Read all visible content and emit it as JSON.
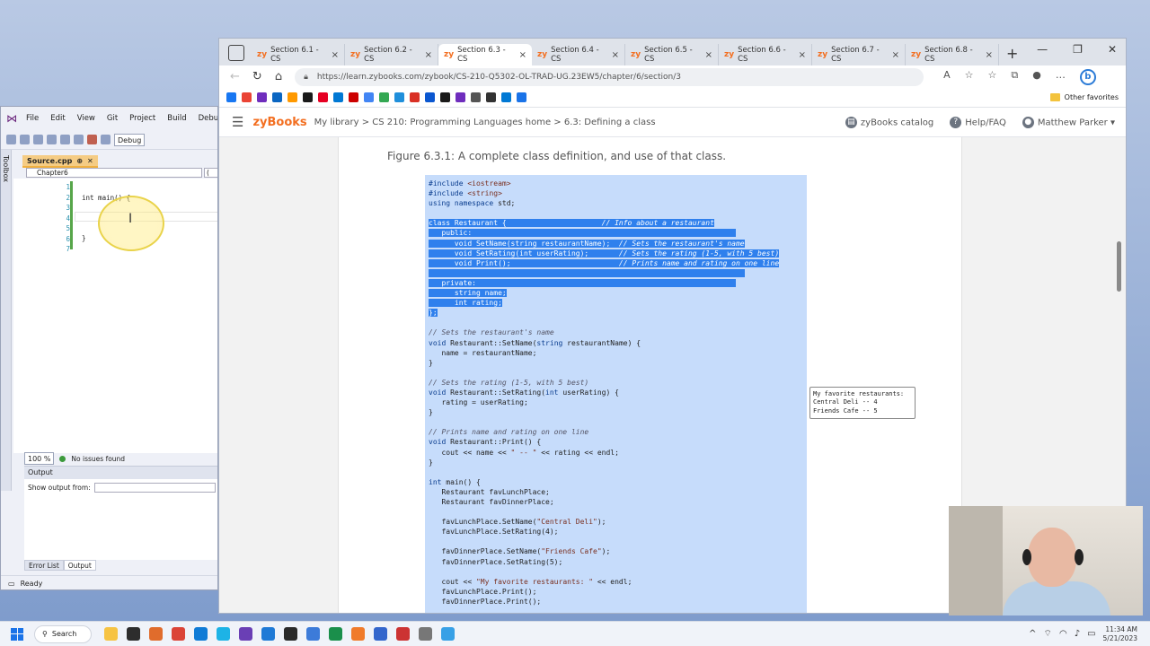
{
  "vs": {
    "menu": [
      "File",
      "Edit",
      "View",
      "Git",
      "Project",
      "Build",
      "Debug"
    ],
    "config": "Debug",
    "toolbox_label": "Toolbox",
    "tab_label": "Source.cpp",
    "tab_pin": "⊕",
    "tab_close": "✕",
    "nav_scope": "Chapter6",
    "nav_scope2": "(",
    "line_numbers": "1\n2\n3\n4\n5\n6\n7",
    "code_line1": "int main() {",
    "code_line2": "}",
    "zoom": "100 %",
    "status": "No issues found",
    "output_title": "Output",
    "show_output_from": "Show output from:",
    "bottom_tabs": [
      "Error List",
      "Output"
    ],
    "ready": "Ready"
  },
  "browser": {
    "tabs": [
      {
        "label": "Section 6.1 - CS"
      },
      {
        "label": "Section 6.2 - CS"
      },
      {
        "label": "Section 6.3 - CS"
      },
      {
        "label": "Section 6.4 - CS"
      },
      {
        "label": "Section 6.5 - CS"
      },
      {
        "label": "Section 6.6 - CS"
      },
      {
        "label": "Section 6.7 - CS"
      },
      {
        "label": "Section 6.8 - CS"
      }
    ],
    "active_tab_index": 2,
    "url": "https://learn.zybooks.com/zybook/CS-210-Q5302-OL-TRAD-UG.23EW5/chapter/6/section/3",
    "other_favorites": "Other favorites",
    "favicons": [
      "#1877f2",
      "#ea4335",
      "#6f2dbd",
      "#0a66c2",
      "#ff9900",
      "#1a1a1a",
      "#e60023",
      "#0078d4",
      "#cc0000",
      "#4285f4",
      "#34a853",
      "#1f8fdb",
      "#d93025",
      "#0b57d0",
      "#1a1a1a",
      "#6f2dbd",
      "#555",
      "#333",
      "#0078d4",
      "#1a73e8"
    ]
  },
  "zybooks": {
    "logo": "zyBooks",
    "breadcrumb": "My library > CS 210: Programming Languages home > 6.3: Defining a class",
    "catalog": "zyBooks catalog",
    "help": "Help/FAQ",
    "user": "Matthew Parker",
    "figure_title": "Figure 6.3.1: A complete class definition, and use of that class.",
    "output_line1": "My favorite restaurants:",
    "output_line2": "Central Deli -- 4",
    "output_line3": "Friends Cafe -- 5"
  },
  "taskbar": {
    "search": "Search",
    "time": "11:34 AM",
    "date": "5/21/2023",
    "app_colors": [
      "#f6c343",
      "#2d2d2d",
      "#e06c2c",
      "#db4437",
      "#0f7bd6",
      "#1db3e6",
      "#6a3fb5",
      "#1f7ad6",
      "#2a2a2a",
      "#3c7bd9",
      "#1a8f4b",
      "#f07b2a",
      "#3366cc",
      "#cc3333",
      "#777777",
      "#38a0e6"
    ]
  }
}
